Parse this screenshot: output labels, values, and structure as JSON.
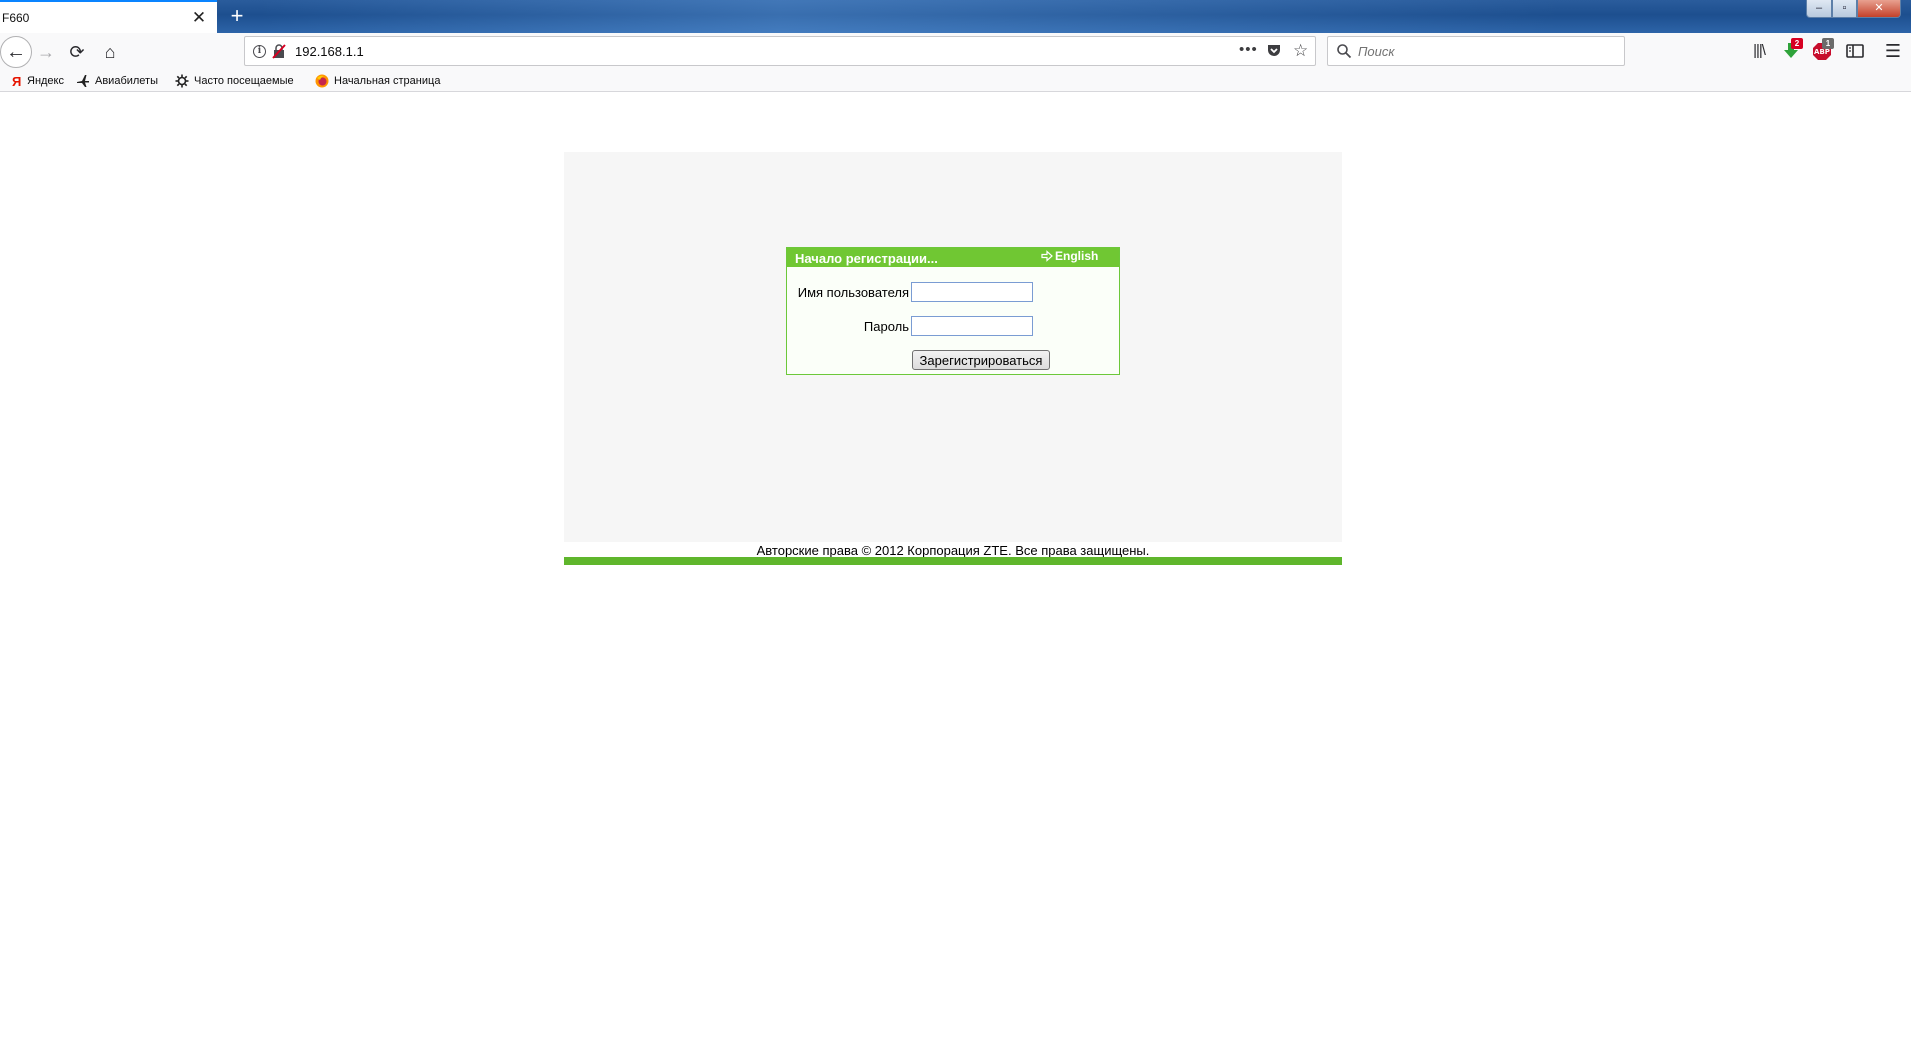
{
  "browser": {
    "tab": {
      "title": "F660",
      "close_glyph": "✕"
    },
    "new_tab_glyph": "+",
    "window_controls": {
      "minimize": "–",
      "maximize": "▫",
      "close": "✕"
    },
    "nav": {
      "back_glyph": "←",
      "forward_glyph": "→",
      "reload_glyph": "⟳",
      "home_glyph": "⌂"
    },
    "url": "192.168.1.1",
    "page_actions_glyph": "•••",
    "bookmark_star_glyph": "☆",
    "search": {
      "placeholder": "Поиск"
    },
    "toolbar": {
      "library_glyph": "|||\\",
      "download_badge": "2",
      "adblock_badge": "1",
      "menu_glyph": "☰"
    },
    "bookmarks": [
      {
        "label": "Яндекс",
        "icon": "yandex-icon"
      },
      {
        "label": "Авиабилеты",
        "icon": "plane-icon"
      },
      {
        "label": "Часто посещаемые",
        "icon": "gear-icon"
      },
      {
        "label": "Начальная страница",
        "icon": "firefox-icon"
      }
    ]
  },
  "page": {
    "login": {
      "title": "Начало регистрации...",
      "language_link": "English",
      "username_label": "Имя пользователя",
      "password_label": "Пароль",
      "username_value": "",
      "password_value": "",
      "submit_label": "Зарегистрироваться"
    },
    "copyright": "Авторские права © 2012 Корпорация ZTE. Все права защищены."
  },
  "colors": {
    "accent_green": "#70c733",
    "footer_green": "#5fb62c",
    "panel_gray": "#f6f6f6",
    "titlebar_blue": "#1d4f8f"
  }
}
